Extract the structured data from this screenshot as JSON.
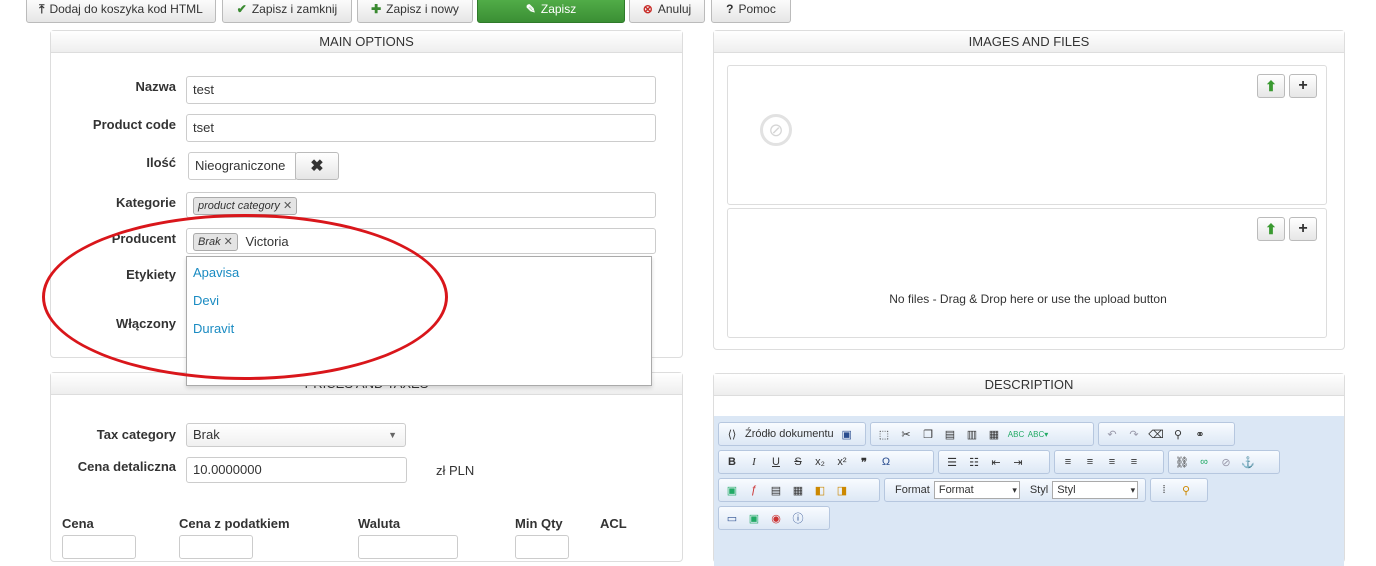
{
  "toolbar": {
    "add_html": "Dodaj do koszyka kod HTML",
    "save_close": "Zapisz i zamknij",
    "save_new": "Zapisz i nowy",
    "save": "Zapisz",
    "cancel": "Anuluj",
    "help": "Pomoc"
  },
  "main_options": {
    "title": "MAIN OPTIONS",
    "labels": {
      "name": "Nazwa",
      "code": "Product code",
      "qty": "Ilość",
      "categories": "Kategorie",
      "producer": "Producent",
      "tags": "Etykiety",
      "enabled": "Włączony"
    },
    "name_value": "test",
    "code_value": "tset",
    "qty_value": "Nieograniczone",
    "category_tag": "product category",
    "producer_tag": "Brak",
    "producer_typed": "Victoria",
    "suggestions": [
      "Apavisa",
      "Devi",
      "Duravit"
    ]
  },
  "prices": {
    "title": "PRICES AND TAXES",
    "tax_label": "Tax category",
    "tax_value": "Brak",
    "retail_label": "Cena detaliczna",
    "retail_value": "10.0000000",
    "currency": "zł PLN",
    "cols": [
      "Cena",
      "Cena z podatkiem",
      "Waluta",
      "Min Qty",
      "ACL"
    ]
  },
  "images": {
    "title": "IMAGES AND FILES",
    "no_files": "No files - Drag & Drop here or use the upload button"
  },
  "description": {
    "title": "DESCRIPTION",
    "source_btn": "Źródło dokumentu",
    "format_label": "Format",
    "format_value": "Format",
    "style_label": "Styl",
    "style_value": "Styl"
  },
  "colors": {
    "accent_green": "#3b8f34",
    "link_blue": "#1a8bc2",
    "annotation_red": "#d9161b"
  }
}
